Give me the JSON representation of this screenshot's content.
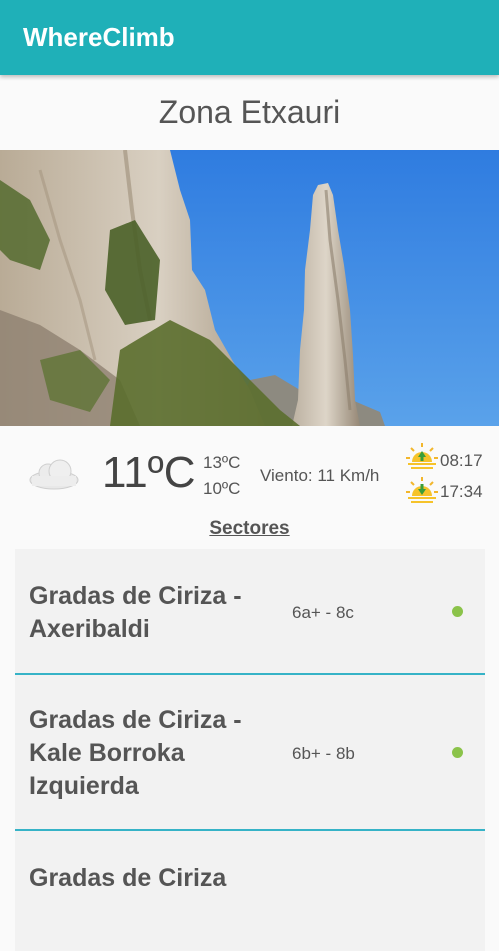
{
  "app": {
    "title": "WhereClimb"
  },
  "zone": {
    "title": "Zona Etxauri"
  },
  "weather": {
    "icon": "cloud-icon",
    "temperature": "11ºC",
    "max": "13ºC",
    "min": "10ºC",
    "wind": "Viento: 11 Km/h",
    "sunrise": "08:17",
    "sunset": "17:34"
  },
  "sectors_heading": "Sectores",
  "sectors": [
    {
      "name": "Gradas de Ciriza - Axeribaldi",
      "grade": "6a+ - 8c",
      "status_color": "#8bc34a"
    },
    {
      "name": "Gradas de Ciriza - Kale Borroka Izquierda",
      "grade": "6b+ - 8b",
      "status_color": "#8bc34a"
    },
    {
      "name": "Gradas de Ciriza",
      "grade": "",
      "status_color": "#8bc34a"
    }
  ],
  "colors": {
    "appbar": "#1fb0b8",
    "divider": "#36b3c7",
    "status_ok": "#8bc34a"
  }
}
